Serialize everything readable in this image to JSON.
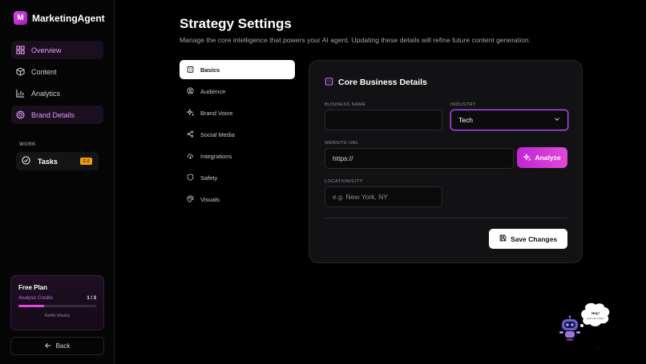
{
  "brand": {
    "logo_letter": "M",
    "name": "MarketingAgent"
  },
  "sidebar": {
    "items": [
      {
        "label": "Overview",
        "icon": "grid-icon",
        "active": true
      },
      {
        "label": "Content",
        "icon": "cube-icon",
        "active": false
      },
      {
        "label": "Analytics",
        "icon": "bar-chart-icon",
        "active": false
      },
      {
        "label": "Brand Details",
        "icon": "gear-icon",
        "active": true
      }
    ],
    "work_label": "WORK",
    "tasks": {
      "label": "Tasks",
      "badge": "C-2"
    },
    "plan": {
      "title": "Free Plan",
      "credits_label": "Analysis Credits",
      "credits_value": "1 / 3",
      "credits_fraction": 0.33,
      "note": "Refills Weekly"
    },
    "back_label": "Back"
  },
  "page": {
    "title": "Strategy Settings",
    "subtitle": "Manage the core intelligence that powers your AI agent. Updating these details will refine future content generation."
  },
  "tabs": [
    {
      "label": "Basics",
      "icon": "building-icon",
      "active": true
    },
    {
      "label": "Audience",
      "icon": "user-circle-icon",
      "active": false
    },
    {
      "label": "Brand Voice",
      "icon": "sparkles-icon",
      "active": false
    },
    {
      "label": "Social Media",
      "icon": "share-icon",
      "active": false
    },
    {
      "label": "Integrations",
      "icon": "cloud-icon",
      "active": false
    },
    {
      "label": "Safety",
      "icon": "shield-icon",
      "active": false
    },
    {
      "label": "Visuals",
      "icon": "palette-icon",
      "active": false
    }
  ],
  "card": {
    "title": "Core Business Details",
    "business_name": {
      "label": "BUSINESS NAME",
      "value": ""
    },
    "industry": {
      "label": "INDUSTRY",
      "value": "Tech"
    },
    "website": {
      "label": "WEBSITE URL",
      "value": "https://"
    },
    "analyze_label": "Analyze",
    "location": {
      "label": "LOCATION/CITY",
      "placeholder": "e.g. New York, NY"
    },
    "save_label": "Save Changes"
  },
  "assistant": {
    "greeting": "Hey!",
    "subtext": "How can I help?",
    "dots": "..."
  },
  "colors": {
    "accent": "#d946ef",
    "background": "#000000",
    "card": "#121214",
    "badge": "#f59e0b"
  }
}
